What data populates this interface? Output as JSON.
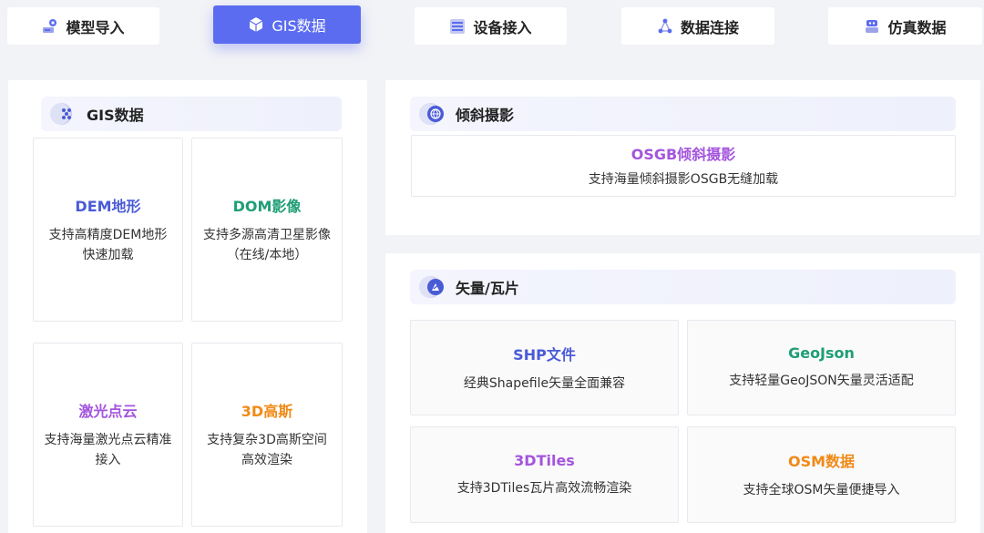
{
  "tabs": [
    {
      "label": "模型导入",
      "icon": "model-import-icon"
    },
    {
      "label": "GIS数据",
      "icon": "cube-icon",
      "active": true
    },
    {
      "label": "设备接入",
      "icon": "device-icon"
    },
    {
      "label": "数据连接",
      "icon": "connection-icon"
    },
    {
      "label": "仿真数据",
      "icon": "robot-icon"
    }
  ],
  "gis": {
    "header": "GIS数据",
    "cards": [
      {
        "title": "DEM地形",
        "desc": "支持高精度DEM地形快速加载",
        "color": "#4a5bd6"
      },
      {
        "title": "DOM影像",
        "desc": "支持多源高清卫星影像（在线/本地）",
        "color": "#1f9e75"
      },
      {
        "title": "激光点云",
        "desc": "支持海量激光点云精准接入",
        "color": "#a455dd"
      },
      {
        "title": "3D高斯",
        "desc": "支持复杂3D高斯空间",
        "desc2": "高效渲染",
        "color": "#f08a16"
      }
    ]
  },
  "oblique": {
    "header": "倾斜摄影",
    "card": {
      "title": "OSGB倾斜摄影",
      "desc": "支持海量倾斜摄影OSGB无缝加载",
      "color": "#a455dd"
    }
  },
  "vector": {
    "header": "矢量/瓦片",
    "cards": [
      {
        "title": "SHP文件",
        "desc": "经典Shapefile矢量全面兼容",
        "color": "#4a5bd6"
      },
      {
        "title": "GeoJson",
        "desc": "支持轻量GeoJSON矢量灵活适配",
        "color": "#1f9e75"
      },
      {
        "title": "3DTiles",
        "desc": "支持3DTiles瓦片高效流畅渲染",
        "color": "#a455dd"
      },
      {
        "title": "OSM数据",
        "desc": "支持全球OSM矢量便捷导入",
        "color": "#f08a16"
      }
    ]
  },
  "colors": {
    "accent": "#5b6cf0",
    "background": "#f2f3f6"
  }
}
